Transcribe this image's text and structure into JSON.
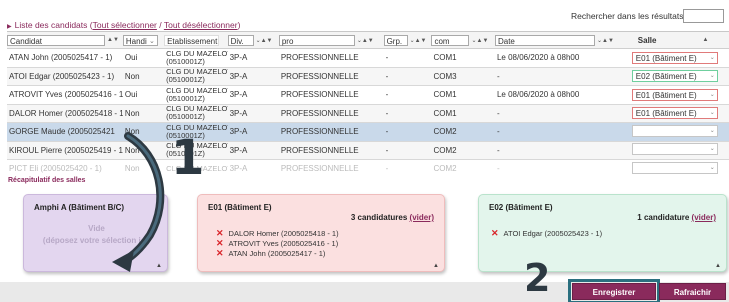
{
  "header": {
    "list_title": "Liste des candidats",
    "open_paren": "(",
    "select_all": "Tout sélectionner",
    "separator": "/",
    "deselect_all": "Tout désélectionner",
    "close_paren": ")",
    "search_label": "Rechercher dans les résultats:"
  },
  "table": {
    "filters": {
      "candidat": "Candidat",
      "handi": "Handi",
      "etab": "Etablissement",
      "div": "Div.",
      "pro": "pro",
      "grp": "Grp.",
      "com": "com",
      "date": "Date",
      "salle": "Salle"
    },
    "rows": [
      {
        "candidat": "ATAN John (2005025417 - 1)",
        "handi": "Oui",
        "etab1": "CLG DU MAZELOT",
        "etab2": "(0510001Z)",
        "div": "3P-A",
        "pro": "PROFESSIONNELLE",
        "grp": "-",
        "com": "COM1",
        "date": "Le 08/06/2020 à 08h00",
        "salle": "E01 (Bâtiment E)",
        "salle_color": "red"
      },
      {
        "candidat": "ATOI Edgar (2005025423 - 1)",
        "handi": "Non",
        "etab1": "CLG DU MAZELOT",
        "etab2": "(0510001Z)",
        "div": "3P-A",
        "pro": "PROFESSIONNELLE",
        "grp": "-",
        "com": "COM3",
        "date": "-",
        "salle": "E02 (Bâtiment E)",
        "salle_color": "green"
      },
      {
        "candidat": "ATROVIT Yves (2005025416 - 1)",
        "handi": "Oui",
        "etab1": "CLG DU MAZELOT",
        "etab2": "(0510001Z)",
        "div": "3P-A",
        "pro": "PROFESSIONNELLE",
        "grp": "-",
        "com": "COM1",
        "date": "Le 08/06/2020 à 08h00",
        "salle": "E01 (Bâtiment E)",
        "salle_color": "red"
      },
      {
        "candidat": "DALOR Homer (2005025418 - 1)",
        "handi": "Non",
        "etab1": "CLG DU MAZELOT",
        "etab2": "(0510001Z)",
        "div": "3P-A",
        "pro": "PROFESSIONNELLE",
        "grp": "-",
        "com": "COM1",
        "date": "-",
        "salle": "E01 (Bâtiment E)",
        "salle_color": "red"
      },
      {
        "candidat": "GORGE Maude (2005025421",
        "handi": "Non",
        "etab1": "CLG DU MAZELOT",
        "etab2": "(0510001Z)",
        "div": "3P-A",
        "pro": "PROFESSIONNELLE",
        "grp": "-",
        "com": "COM2",
        "date": "-",
        "salle": "",
        "salle_color": "none"
      },
      {
        "candidat": "KIROUL Pierre (2005025419 - 1)",
        "handi": "Non",
        "etab1": "CLG DU MAZELOT",
        "etab2": "(0510001Z)",
        "div": "3P-A",
        "pro": "PROFESSIONNELLE",
        "grp": "-",
        "com": "COM2",
        "date": "-",
        "salle": "",
        "salle_color": "none"
      },
      {
        "candidat": "PICT Eli (2005025420 - 1)",
        "handi": "Non",
        "etab1": "CLG DU MAZELOT",
        "etab2": "",
        "div": "3P-A",
        "pro": "PROFESSIONNELLE",
        "grp": "-",
        "com": "COM2",
        "date": "-",
        "salle": "",
        "salle_color": "none"
      }
    ]
  },
  "recap": {
    "title": "Récapitulatif des salles",
    "amphi": {
      "title": "Amphi A (Bâtiment B/C)",
      "empty": "Vide",
      "hint": "(déposez votre sélection ici)"
    },
    "e01": {
      "title": "E01 (Bâtiment E)",
      "count": "3 candidatures",
      "empty_link": "(vider)",
      "candidates": [
        "DALOR Homer (2005025418 - 1)",
        "ATROVIT Yves (2005025416 - 1)",
        "ATAN John (2005025417 - 1)"
      ]
    },
    "e02": {
      "title": "E02 (Bâtiment E)",
      "count": "1 candidature",
      "empty_link": "(vider)",
      "candidates": [
        "ATOI Edgar (2005025423 - 1)"
      ]
    }
  },
  "buttons": {
    "save": "Enregistrer",
    "refresh": "Rafraichir"
  },
  "annotations": {
    "step1": "1",
    "step2": "2"
  },
  "colors": {
    "accent": "#8a2a5c",
    "selected_row": "#c9d9ea",
    "annotation": "#2d3942"
  },
  "icons": [
    "sort-arrows-icon",
    "chevron-down-icon",
    "remove-x-icon",
    "resize-corner-icon",
    "curved-arrow-icon"
  ]
}
